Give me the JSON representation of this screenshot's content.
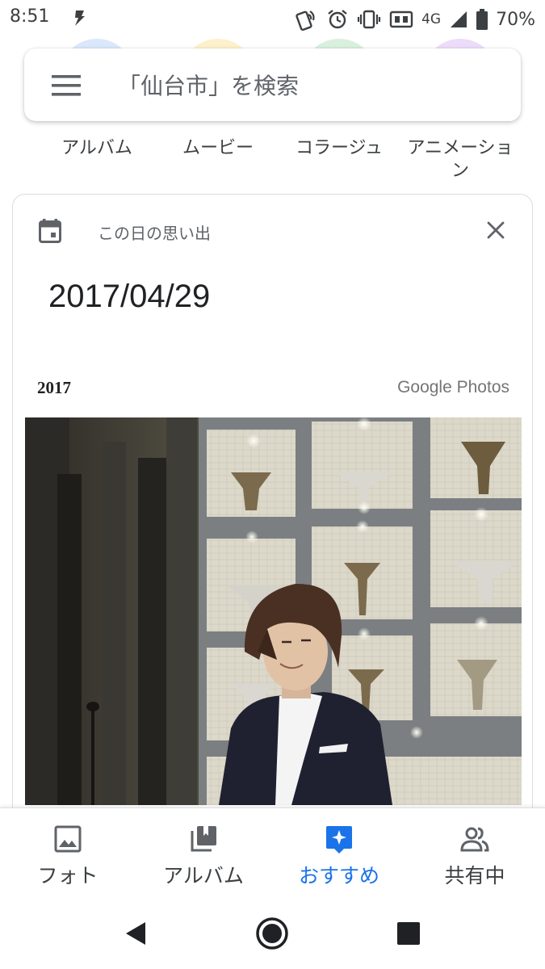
{
  "status_bar": {
    "time": "8:51",
    "network": "4G",
    "battery": "70%"
  },
  "search": {
    "placeholder": "「仙台市」を検索"
  },
  "categories": [
    {
      "label": "アルバム",
      "color": "#dbe7fb"
    },
    {
      "label": "ムービー",
      "color": "#fdf1cc"
    },
    {
      "label": "コラージュ",
      "color": "#d8f0dd"
    },
    {
      "label": "アニメーション",
      "color": "#ecdcf9"
    }
  ],
  "memory_card": {
    "caption": "この日の思い出",
    "date": "2017/04/29",
    "year": "2017",
    "brand": "Google Photos"
  },
  "bottom_nav": {
    "items": [
      {
        "label": "フォト",
        "icon": "photo-icon"
      },
      {
        "label": "アルバム",
        "icon": "albums-icon"
      },
      {
        "label": "おすすめ",
        "icon": "for-you-icon",
        "active": true
      },
      {
        "label": "共有中",
        "icon": "sharing-icon"
      }
    ],
    "active_color": "#1a73e8"
  },
  "system_nav": {
    "buttons": [
      "back-icon",
      "home-icon",
      "recents-icon"
    ]
  }
}
